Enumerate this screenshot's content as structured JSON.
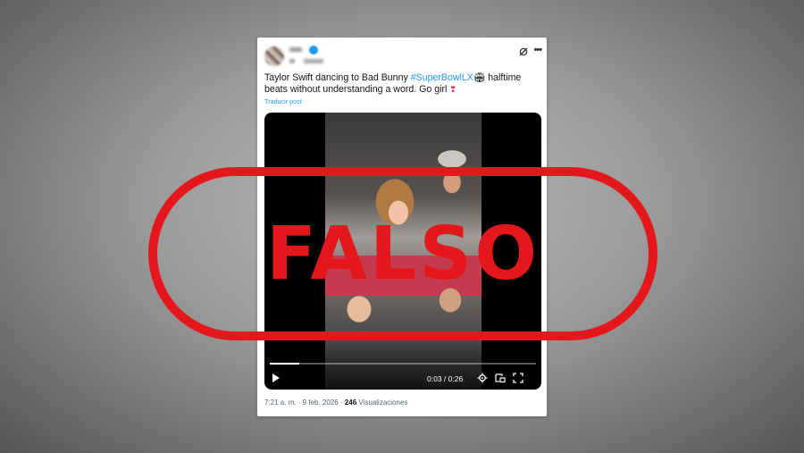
{
  "post": {
    "text_before": "Taylor Swift dancing to Bad Bunny ",
    "hashtag": "#SuperBowlLX",
    "text_after": " halftime beats without understanding a word. Go girl",
    "translate_label": "Traducir post",
    "meta_time": "7:21 a. m. · 9 feb. 2026 · ",
    "views_count": "246",
    "views_label": " Visualizaciones"
  },
  "video": {
    "time": "0:03 / 0:26",
    "progress": 0.11
  },
  "stamp": {
    "label": "FALSO",
    "color": "#e4181c"
  },
  "icons": {
    "grok": "grok-icon",
    "more": "more-options-icon",
    "play": "play-icon",
    "settings": "settings-icon",
    "pip": "picture-in-picture-icon",
    "fullscreen": "fullscreen-icon",
    "stadium_emoji": "stadium-emoji-icon",
    "heart_emoji": "heart-emoji-icon"
  }
}
